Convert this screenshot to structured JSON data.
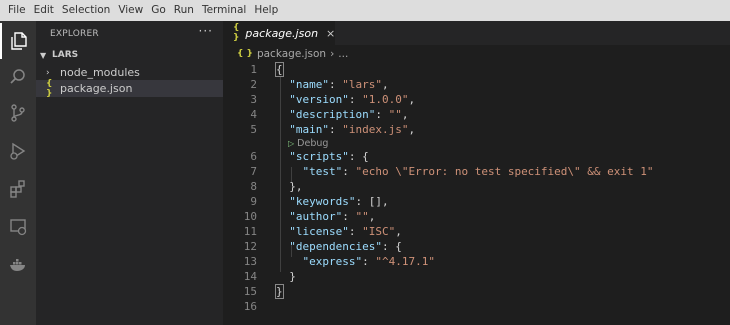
{
  "menu": [
    "File",
    "Edit",
    "Selection",
    "View",
    "Go",
    "Run",
    "Terminal",
    "Help"
  ],
  "activity_bar": [
    {
      "name": "explorer",
      "icon": "files-icon",
      "active": true
    },
    {
      "name": "search",
      "icon": "search-icon",
      "active": false
    },
    {
      "name": "source-control",
      "icon": "source-control-icon",
      "active": false
    },
    {
      "name": "run-debug",
      "icon": "run-debug-icon",
      "active": false
    },
    {
      "name": "extensions",
      "icon": "extensions-icon",
      "active": false
    },
    {
      "name": "remote-explorer",
      "icon": "remote-explorer-icon",
      "active": false
    },
    {
      "name": "docker",
      "icon": "docker-icon",
      "active": false
    }
  ],
  "sidebar": {
    "title": "EXPLORER",
    "more": "···",
    "section": "LARS",
    "items": [
      {
        "label": "node_modules",
        "type": "folder"
      },
      {
        "label": "package.json",
        "type": "json",
        "icon_text": "{ }"
      }
    ]
  },
  "tab": {
    "label": "package.json",
    "icon_text": "{ }",
    "close": "×"
  },
  "breadcrumb": {
    "file": "package.json",
    "icon_text": "{ }",
    "sep": "›",
    "more": "..."
  },
  "editor": {
    "codelens": "Debug",
    "lines": [
      {
        "n": "1",
        "text": "{"
      },
      {
        "n": "2",
        "text": "  \"name\": \"lars\","
      },
      {
        "n": "3",
        "text": "  \"version\": \"1.0.0\","
      },
      {
        "n": "4",
        "text": "  \"description\": \"\","
      },
      {
        "n": "5",
        "text": "  \"main\": \"index.js\","
      },
      {
        "n": "6",
        "text": "  \"scripts\": {"
      },
      {
        "n": "7",
        "text": "    \"test\": \"echo \\\"Error: no test specified\\\" && exit 1\""
      },
      {
        "n": "8",
        "text": "  },"
      },
      {
        "n": "9",
        "text": "  \"keywords\": [],"
      },
      {
        "n": "10",
        "text": "  \"author\": \"\","
      },
      {
        "n": "11",
        "text": "  \"license\": \"ISC\","
      },
      {
        "n": "12",
        "text": "  \"dependencies\": {"
      },
      {
        "n": "13",
        "text": "    \"express\": \"^4.17.1\""
      },
      {
        "n": "14",
        "text": "  }"
      },
      {
        "n": "15",
        "text": "}"
      },
      {
        "n": "16",
        "text": ""
      }
    ]
  },
  "colors": {
    "key": "#9cdcfe",
    "string": "#ce9178",
    "punct": "#d4d4d4",
    "json_icon": "#cbcb41"
  }
}
